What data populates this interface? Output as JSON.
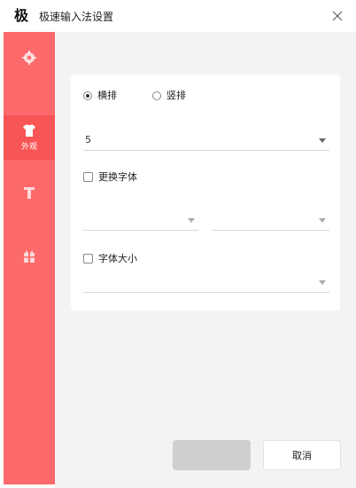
{
  "window": {
    "logo": "极",
    "title": "极速输入法设置"
  },
  "sidebar": {
    "items": [
      {
        "label": "",
        "icon": "gear-icon"
      },
      {
        "label": "外观",
        "icon": "shirt-icon"
      },
      {
        "label": "",
        "icon": "font-icon"
      },
      {
        "label": "",
        "icon": "gift-icon"
      }
    ]
  },
  "content": {
    "section_title": "",
    "orientation": {
      "options": [
        "横排",
        "竖排"
      ],
      "selected": "横排"
    },
    "candidate_count": {
      "label": "",
      "value": "5"
    },
    "change_font": {
      "label": "更换字体",
      "checked": false,
      "chinese_label": "",
      "english_label": "",
      "chinese_value": "",
      "english_value": ""
    },
    "font_size": {
      "label": "字体大小",
      "checked": false,
      "value": ""
    }
  },
  "buttons": {
    "ok": "",
    "cancel": "取消"
  },
  "colors": {
    "sidebar_bg": "#fd6a6b",
    "sidebar_active": "#f85556",
    "content_bg": "#f3f3f3"
  }
}
